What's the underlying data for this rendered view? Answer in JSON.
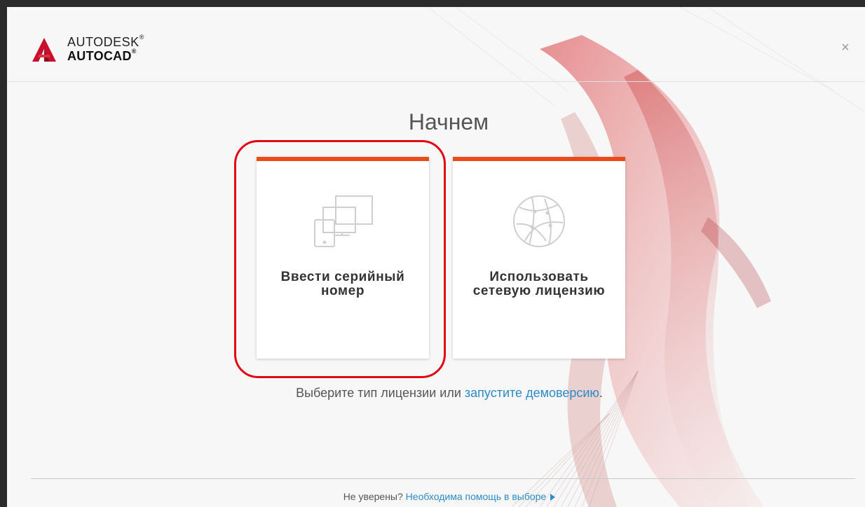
{
  "header": {
    "brand_line1": "AUTODESK",
    "brand_line2": "AUTOCAD",
    "reg_mark": "®",
    "close_symbol": "×"
  },
  "main": {
    "title": "Начнем",
    "options": [
      {
        "label_line1": "Ввести серийный",
        "label_line2": "номер",
        "icon": "devices-icon",
        "accent": "#e94b1b"
      },
      {
        "label_line1": "Использовать",
        "label_line2": "сетевую лицензию",
        "icon": "network-globe-icon",
        "accent": "#e94b1b"
      }
    ],
    "hint_text": "Выберите тип лицензии или ",
    "hint_link": "запустите демоверсию",
    "hint_end": "."
  },
  "footer": {
    "question": "Не уверены? ",
    "help_link": "Необходима помощь в выборе"
  },
  "colors": {
    "accent": "#e94b1b",
    "link": "#2d8bc8",
    "highlight": "#e30613"
  }
}
